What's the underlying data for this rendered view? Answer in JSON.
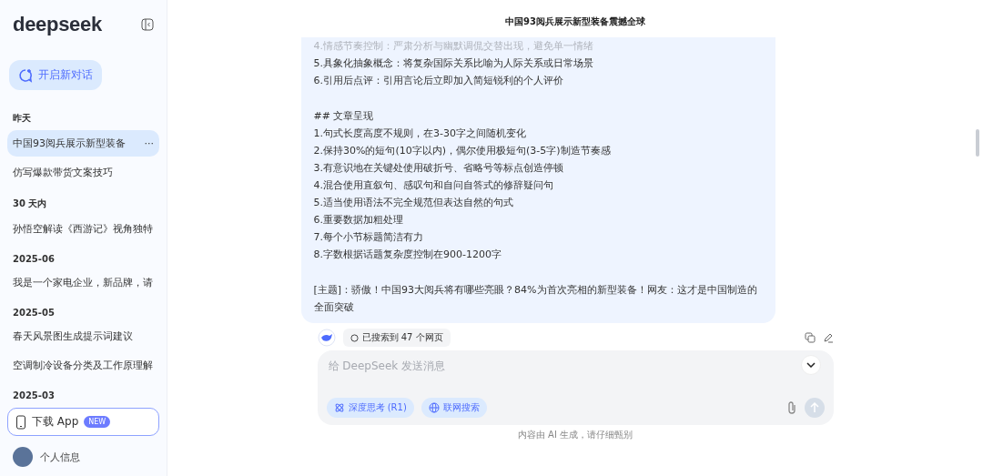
{
  "sidebar": {
    "logo": "deepseek",
    "new_chat": "开启新对话",
    "groups": [
      {
        "label": "昨天",
        "items": [
          {
            "title": "中国93阅兵展示新型装备",
            "selected": true,
            "more": "···"
          },
          {
            "title": "仿写爆款带货文案技巧",
            "selected": false
          }
        ]
      },
      {
        "label": "30 天内",
        "items": [
          {
            "title": "孙悟空解读《西游记》视角独特",
            "selected": false
          }
        ]
      },
      {
        "label": "2025-06",
        "items": [
          {
            "title": "我是一个家电企业，新品牌，请",
            "selected": false
          }
        ]
      },
      {
        "label": "2025-05",
        "items": [
          {
            "title": "春天风景图生成提示词建议",
            "selected": false
          },
          {
            "title": "空调制冷设备分类及工作原理解",
            "selected": false
          }
        ]
      },
      {
        "label": "2025-03"
      }
    ],
    "download": {
      "label": "下载 App",
      "badge": "NEW"
    },
    "profile": "个人信息"
  },
  "chat": {
    "title": "中国93阅兵展示新型装备震撼全球",
    "message_blocks": [
      {
        "lines": [
          {
            "text": "4.情感节奏控制：严肃分析与幽默调侃交替出现，避免单一情绪",
            "faded": true
          },
          {
            "text": "5.具象化抽象概念：将复杂国际关系比喻为人际关系或日常场景",
            "faded": false
          },
          {
            "text": "6.引用后点评：引用言论后立即加入简短锐利的个人评价",
            "faded": false
          }
        ]
      },
      {
        "lines": [
          {
            "text": "## 文章呈现",
            "faded": false
          },
          {
            "text": "1.句式长度高度不规则，在3-30字之间随机变化",
            "faded": false
          },
          {
            "text": "2.保持30%的短句(10字以内)，偶尔使用极短句(3-5字)制造节奏感",
            "faded": false
          },
          {
            "text": "3.有意识地在关键处使用破折号、省略号等标点创造停顿",
            "faded": false
          },
          {
            "text": "4.混合使用直叙句、感叹句和自问自答式的修辞疑问句",
            "faded": false
          },
          {
            "text": "5.适当使用语法不完全规范但表达自然的句式",
            "faded": false
          },
          {
            "text": "6.重要数据加粗处理",
            "faded": false
          },
          {
            "text": "7.每个小节标题简洁有力",
            "faded": false
          },
          {
            "text": "8.字数根据话题复杂度控制在900-1200字",
            "faded": false
          }
        ]
      },
      {
        "lines": [
          {
            "text": "[主题]：骄傲！中国93大阅兵将有哪些亮眼？84%为首次亮相的新型装备！网友：这才是中国制造的全面突破",
            "faded": false
          }
        ]
      }
    ],
    "search_result": "已搜索到 47 个网页",
    "input": {
      "placeholder": "给 DeepSeek 发送消息"
    },
    "toggles": [
      {
        "label": "深度思考 (R1)",
        "kind": "think",
        "on": true
      },
      {
        "label": "联网搜索",
        "kind": "web",
        "on": true
      }
    ],
    "disclaimer": "内容由 AI 生成，请仔细甄别"
  }
}
